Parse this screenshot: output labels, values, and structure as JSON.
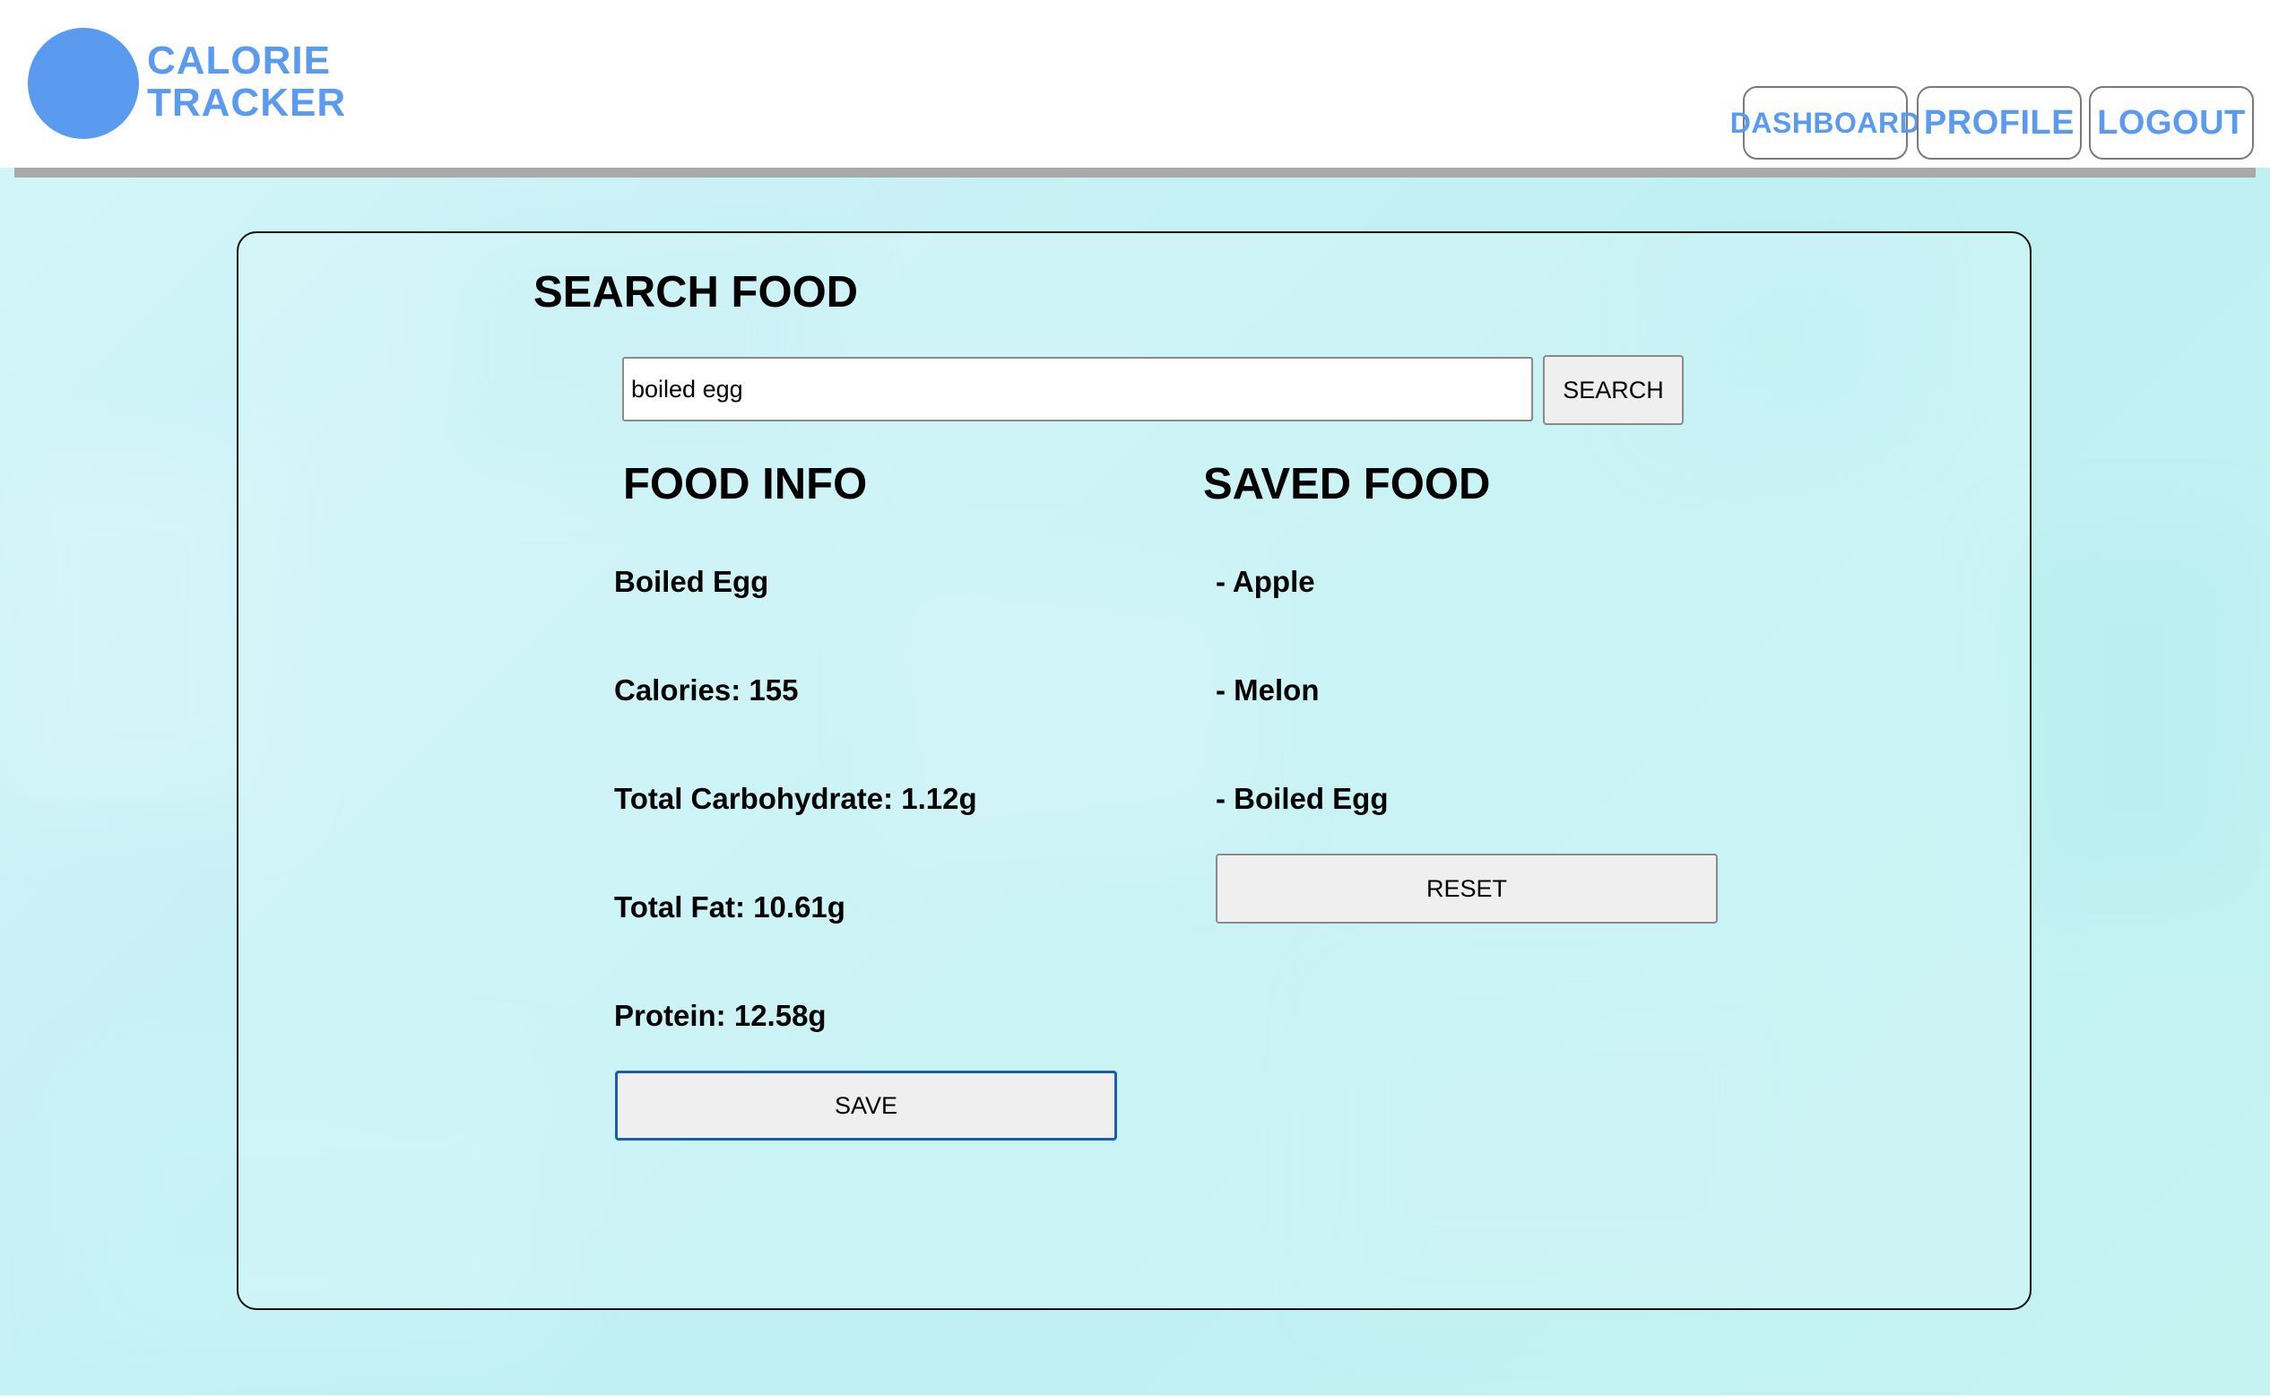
{
  "brand": {
    "line1": "CALORIE",
    "line2": "TRACKER",
    "color": "#5b9bef"
  },
  "nav": {
    "dashboard": "DASHBOARD",
    "profile": "PROFILE",
    "logout": "LOGOUT"
  },
  "search": {
    "title": "SEARCH FOOD",
    "value": "boiled egg",
    "button": "SEARCH"
  },
  "food_info": {
    "title": "FOOD INFO",
    "name": "Boiled Egg",
    "calories": "Calories: 155",
    "carbs": "Total Carbohydrate: 1.12g",
    "fat": "Total Fat: 10.61g",
    "protein": "Protein: 12.58g",
    "save_button": "SAVE"
  },
  "saved_food": {
    "title": "SAVED FOOD",
    "items": [
      "- Apple",
      "- Melon",
      "- Boiled Egg"
    ],
    "reset_button": "RESET"
  },
  "colors": {
    "accent": "#5b9bef",
    "background": "#c9f1f5",
    "save_border": "#1a5cb8"
  }
}
